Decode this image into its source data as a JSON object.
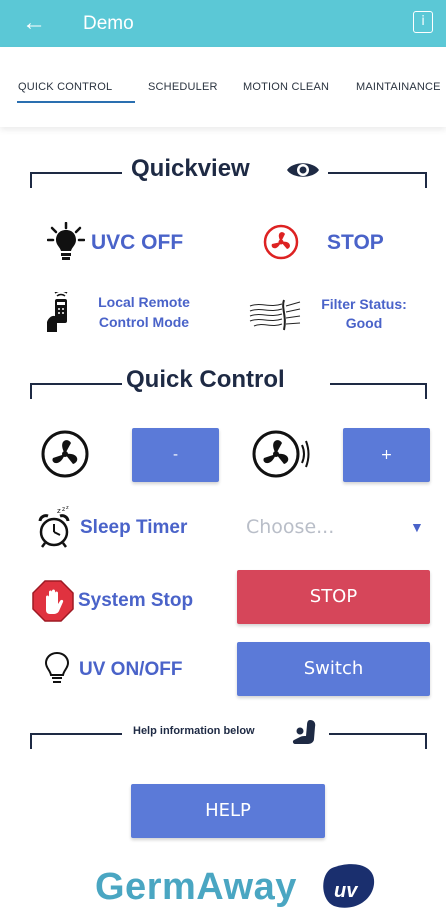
{
  "header": {
    "title": "Demo",
    "back_icon": "arrow-left-icon",
    "info_icon": "info-icon",
    "bg_color": "#5bc8d6"
  },
  "tabs": [
    {
      "label": "QUICK CONTROL",
      "active": true
    },
    {
      "label": "SCHEDULER",
      "active": false
    },
    {
      "label": "MOTION CLEAN",
      "active": false
    },
    {
      "label": "MAINTAINANCE",
      "active": false
    }
  ],
  "quickview": {
    "title": "Quickview",
    "uvc_status": "UVC OFF",
    "fan_status": "STOP",
    "remote_line1": "Local Remote",
    "remote_line2": "Control Mode",
    "filter_line1": "Filter Status:",
    "filter_line2": "Good"
  },
  "quick_control": {
    "title": "Quick Control",
    "decrease_label": "-",
    "increase_label": "+",
    "sleep_timer_label": "Sleep Timer",
    "sleep_timer_placeholder": "Choose...",
    "system_stop_label": "System Stop",
    "stop_button": "STOP",
    "uv_label": "UV ON/OFF",
    "switch_button": "Switch"
  },
  "help": {
    "title": "Help information below",
    "button": "HELP"
  },
  "brand": {
    "logo_text": "GermAway",
    "badge_text": "uv"
  },
  "colors": {
    "accent": "#4a63c9",
    "button_blue": "#5b7ad8",
    "button_red": "#d6465a",
    "dark": "#1e2a44"
  }
}
